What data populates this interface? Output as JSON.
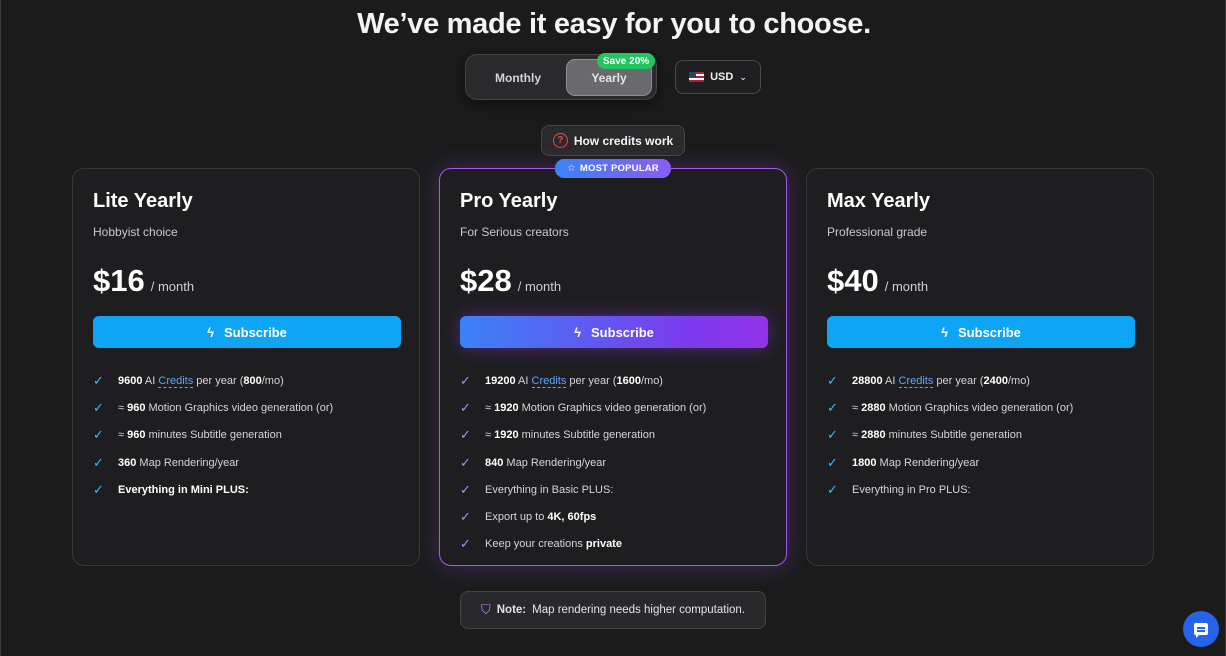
{
  "headline": "We’ve made it easy for you to choose.",
  "billing_toggle": {
    "monthly_label": "Monthly",
    "yearly_label": "Yearly",
    "selected": "Yearly",
    "save_badge": "Save 20%"
  },
  "currency": {
    "flag_icon": "us-flag-icon",
    "value": "USD"
  },
  "how_credits_label": "How credits work",
  "popular_badge": "MOST POPULAR",
  "colors": {
    "background": "#1b1b1c",
    "subscribe_blue": "#0ea5f4",
    "pro_gradient_start": "#3b82f6",
    "pro_gradient_end": "#9333ea",
    "save_green": "#22c55e"
  },
  "plans": [
    {
      "name": "Lite Yearly",
      "tagline": "Hobbyist choice",
      "price": "$16",
      "period": "/ month",
      "cta": "Subscribe",
      "features": [
        {
          "a": "9600",
          "b": " AI ",
          "link": "Credits",
          "c": " per year (",
          "d": "800",
          "e": "/mo)"
        },
        {
          "a": "≈ ",
          "b": "960",
          "c": " Motion Graphics video generation (or)"
        },
        {
          "a": "≈ ",
          "b": "960",
          "c": " minutes Subtitle generation"
        },
        {
          "a": "360",
          "c": " Map Rendering/year"
        },
        {
          "a": "Everything in Mini PLUS:"
        }
      ]
    },
    {
      "name": "Pro Yearly",
      "tagline": "For Serious creators",
      "price": "$28",
      "period": "/ month",
      "cta": "Subscribe",
      "features": [
        {
          "a": "19200",
          "b": " AI ",
          "link": "Credits",
          "c": " per year (",
          "d": "1600",
          "e": "/mo)"
        },
        {
          "a": "≈ ",
          "b": "1920",
          "c": " Motion Graphics video generation (or)"
        },
        {
          "a": "≈ ",
          "b": "1920",
          "c": " minutes Subtitle generation"
        },
        {
          "a": "840",
          "c": " Map Rendering/year"
        },
        {
          "c": "Everything in Basic PLUS:"
        },
        {
          "c": "Export up to ",
          "b": "4K, 60fps"
        },
        {
          "c": "Keep your creations ",
          "b": "private"
        }
      ]
    },
    {
      "name": "Max Yearly",
      "tagline": "Professional grade",
      "price": "$40",
      "period": "/ month",
      "cta": "Subscribe",
      "features": [
        {
          "a": "28800",
          "b": " AI ",
          "link": "Credits",
          "c": " per year (",
          "d": "2400",
          "e": "/mo)"
        },
        {
          "a": "≈ ",
          "b": "2880",
          "c": " Motion Graphics video generation (or)"
        },
        {
          "a": "≈ ",
          "b": "2880",
          "c": " minutes Subtitle generation"
        },
        {
          "a": "1800",
          "c": " Map Rendering/year"
        },
        {
          "c": "Everything in Pro PLUS:"
        }
      ]
    }
  ],
  "note": {
    "label": "Note:",
    "text": " Map rendering needs higher computation."
  },
  "chat_icon": "chat-bubble-icon"
}
